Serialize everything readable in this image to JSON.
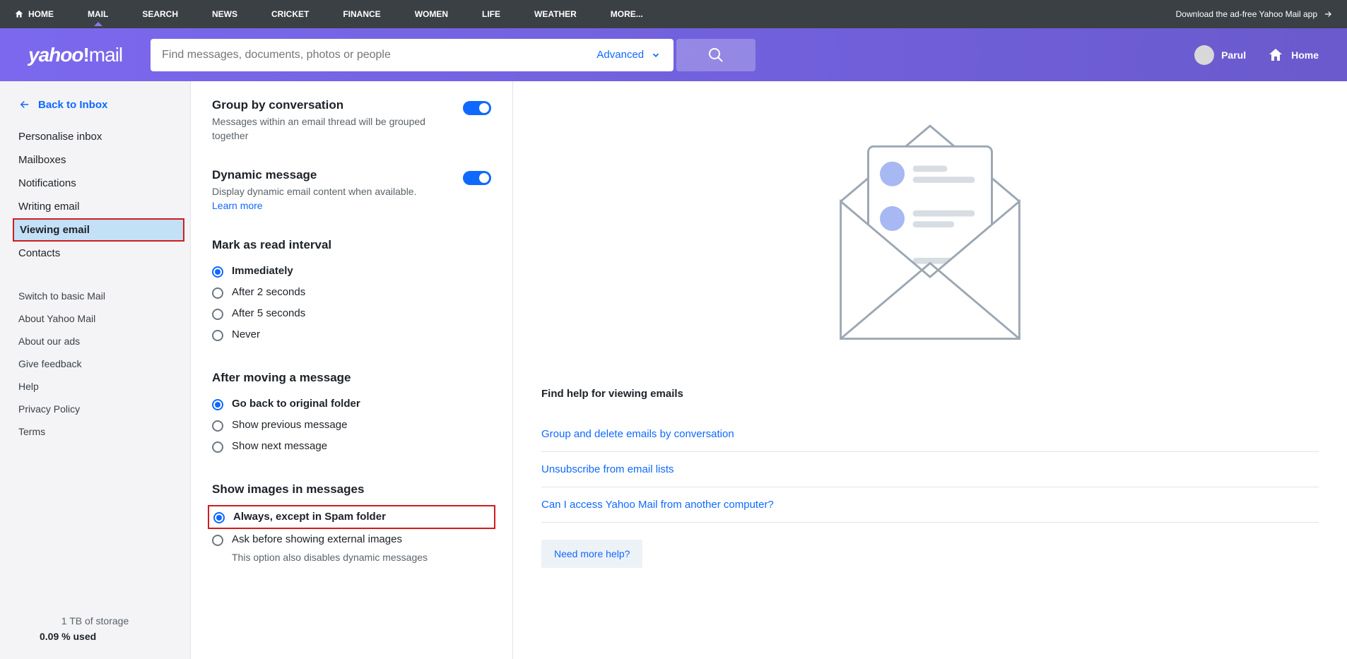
{
  "topnav": {
    "items": [
      "HOME",
      "MAIL",
      "SEARCH",
      "NEWS",
      "CRICKET",
      "FINANCE",
      "WOMEN",
      "LIFE",
      "WEATHER",
      "MORE..."
    ],
    "download": "Download the ad-free Yahoo Mail app"
  },
  "header": {
    "logo": "yahoo!mail",
    "search_placeholder": "Find messages, documents, photos or people",
    "advanced": "Advanced",
    "user": "Parul",
    "home": "Home"
  },
  "sidebar": {
    "back": "Back to Inbox",
    "items": [
      "Personalise inbox",
      "Mailboxes",
      "Notifications",
      "Writing email",
      "Viewing email",
      "Contacts"
    ],
    "sub": [
      "Switch to basic Mail",
      "About Yahoo Mail",
      "About our ads",
      "Give feedback",
      "Help",
      "Privacy Policy",
      "Terms"
    ],
    "storage_line1": "1 TB of storage",
    "storage_line2": "0.09 % used"
  },
  "settings": {
    "group_title": "Group by conversation",
    "group_desc": "Messages within an email thread will be grouped together",
    "dynamic_title": "Dynamic message",
    "dynamic_desc": "Display dynamic email content when available.",
    "learn_more": "Learn more",
    "mark_title": "Mark as read interval",
    "mark_options": [
      "Immediately",
      "After 2 seconds",
      "After 5 seconds",
      "Never"
    ],
    "move_title": "After moving a message",
    "move_options": [
      "Go back to original folder",
      "Show previous message",
      "Show next message"
    ],
    "images_title": "Show images in messages",
    "images_opt0": "Always, except in Spam folder",
    "images_opt1": "Ask before showing external images",
    "images_opt1_sub": "This option also disables dynamic messages"
  },
  "help": {
    "title": "Find help for viewing emails",
    "links": [
      "Group and delete emails by conversation",
      "Unsubscribe from email lists",
      "Can I access Yahoo Mail from another computer?"
    ],
    "more": "Need more help?"
  }
}
